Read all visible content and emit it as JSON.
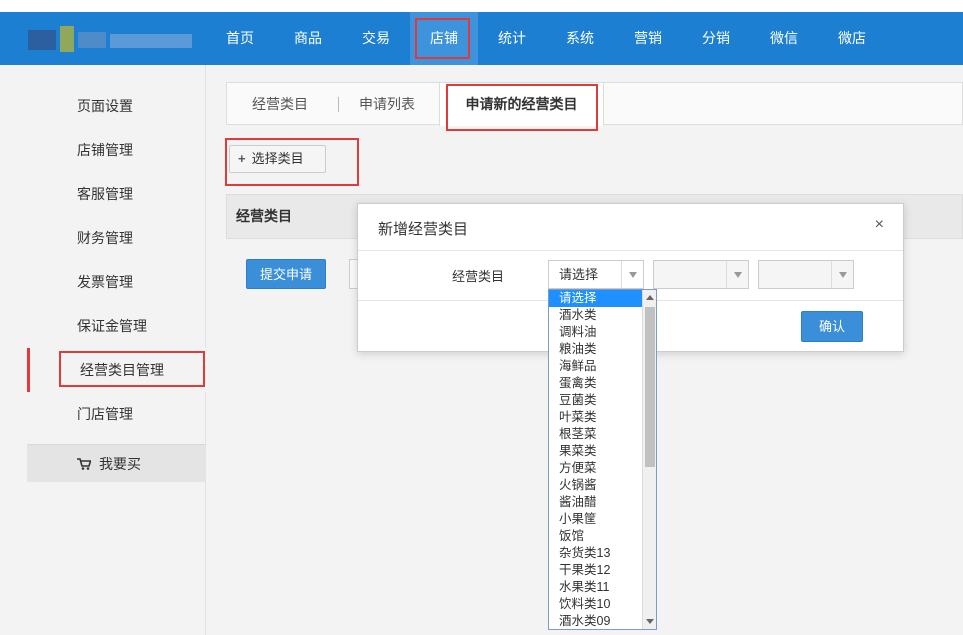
{
  "nav": {
    "items": [
      {
        "label": "首页"
      },
      {
        "label": "商品"
      },
      {
        "label": "交易"
      },
      {
        "label": "店铺"
      },
      {
        "label": "统计"
      },
      {
        "label": "系统"
      },
      {
        "label": "营销"
      },
      {
        "label": "分销"
      },
      {
        "label": "微信"
      },
      {
        "label": "微店"
      }
    ],
    "active": "店铺"
  },
  "sidebar": {
    "items": [
      {
        "label": "页面设置"
      },
      {
        "label": "店铺管理"
      },
      {
        "label": "客服管理"
      },
      {
        "label": "财务管理"
      },
      {
        "label": "发票管理"
      },
      {
        "label": "保证金管理"
      },
      {
        "label": "经营类目管理"
      },
      {
        "label": "门店管理"
      }
    ],
    "active": "经营类目管理",
    "buy_button": "我要买"
  },
  "tabs": [
    {
      "label": "经营类目"
    },
    {
      "label": "申请列表"
    },
    {
      "label": "申请新的经营类目"
    }
  ],
  "select_category_button": "选择类目",
  "band_header": "经营类目",
  "submit_button": "提交申请",
  "modal": {
    "title": "新增经营类目",
    "close": "×",
    "field_label": "经营类目",
    "select1_value": "请选择",
    "confirm": "确认"
  },
  "dropdown": {
    "options": [
      "请选择",
      "酒水类",
      "调料油",
      "粮油类",
      "海鲜品",
      "蛋禽类",
      "豆菌类",
      "叶菜类",
      "根茎菜",
      "果菜类",
      "方便菜",
      "火锅酱",
      "酱油醋",
      "小果筐",
      "饭馆",
      "杂货类13",
      "干果类12",
      "水果类11",
      "饮料类10",
      "酒水类09"
    ],
    "selected": "请选择"
  },
  "colors": {
    "nav_bg": "#1c7fd1",
    "primary_button": "#3b8fd8",
    "highlight_red": "#e03a3a",
    "dropdown_selected": "#1e90ff"
  }
}
